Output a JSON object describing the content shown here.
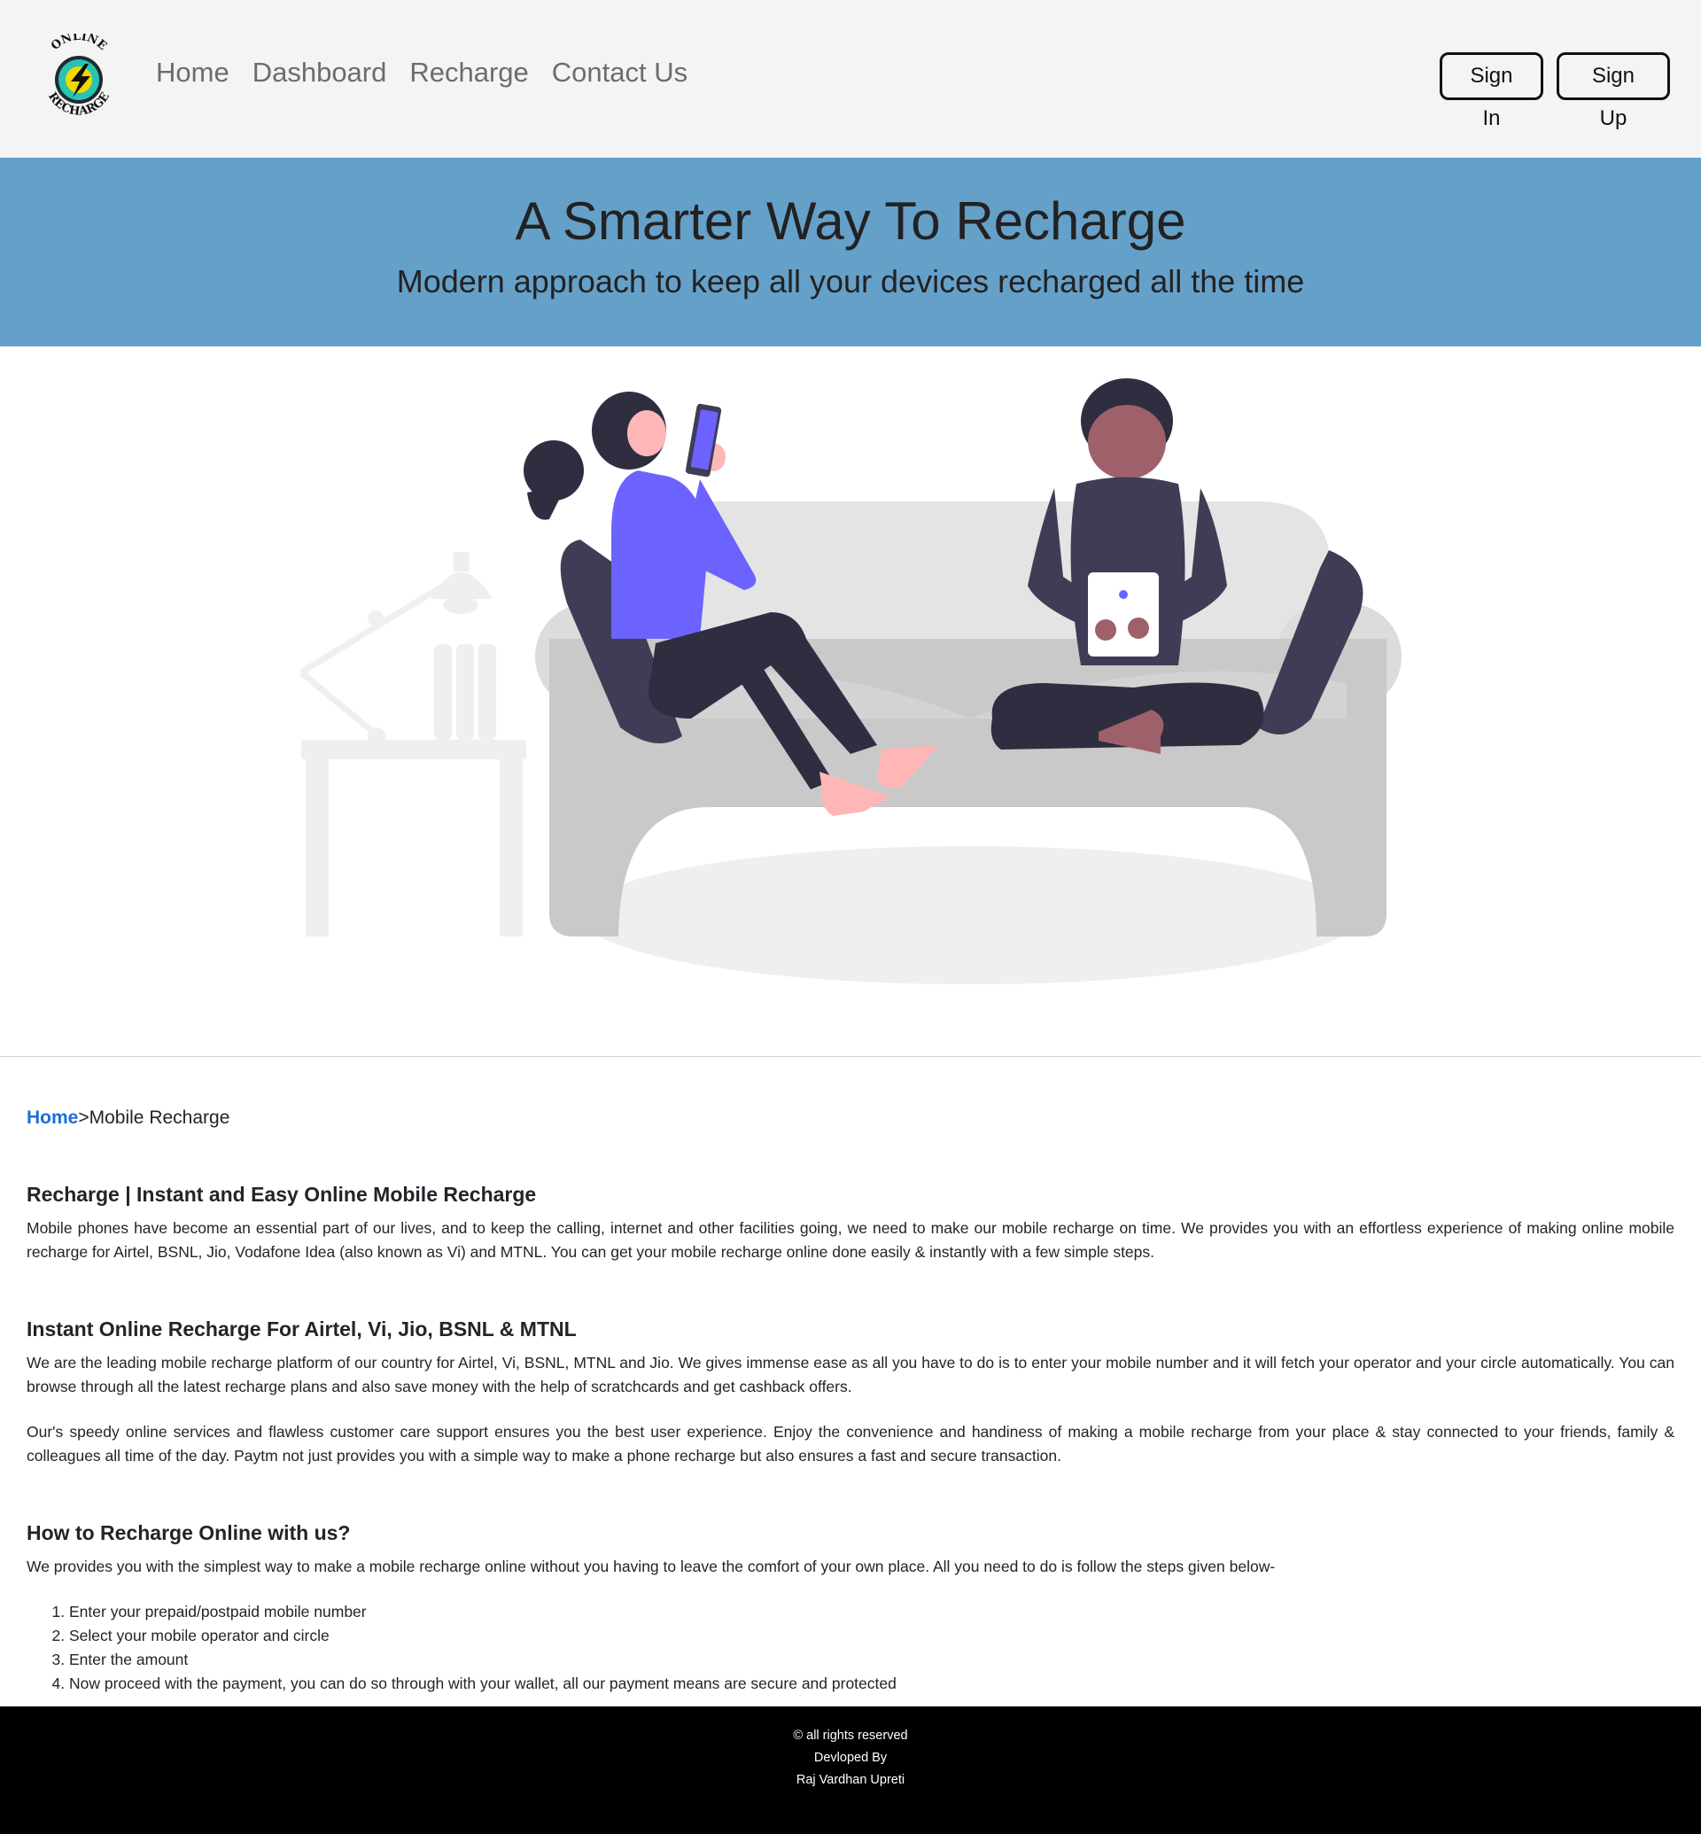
{
  "brand": {
    "logo_text_top": "ONLINE",
    "logo_text_bottom": "RECHARGE"
  },
  "nav": {
    "links": [
      "Home",
      "Dashboard",
      "Recharge",
      "Contact Us"
    ],
    "sign_in": "Sign In",
    "sign_up": "Sign Up"
  },
  "hero": {
    "title": "A Smarter Way To Recharge",
    "subtitle": "Modern approach to keep all your devices recharged all the time"
  },
  "breadcrumb": {
    "home": "Home",
    "separator": ">",
    "current": "Mobile Recharge"
  },
  "sections": [
    {
      "heading": "Recharge | Instant and Easy Online Mobile Recharge",
      "paragraphs": [
        "Mobile phones have become an essential part of our lives, and to keep the calling, internet and other facilities going, we need to make our mobile recharge on time. We provides you with an effortless experience of making online mobile recharge for Airtel, BSNL, Jio, Vodafone Idea (also known as Vi) and MTNL. You can get your mobile recharge online done easily & instantly with a few simple steps."
      ]
    },
    {
      "heading": "Instant Online Recharge For Airtel, Vi, Jio, BSNL & MTNL",
      "paragraphs": [
        "We are the leading mobile recharge platform of our country for Airtel, Vi, BSNL, MTNL and Jio. We gives immense ease as all you have to do is to enter your mobile number and it will fetch your operator and your circle automatically. You can browse through all the latest recharge plans and also save money with the help of scratchcards and get cashback offers.",
        "Our's speedy online services and flawless customer care support ensures you the best user experience. Enjoy the convenience and handiness of making a mobile recharge from your place & stay connected to your friends, family & colleagues all time of the day. Paytm not just provides you with a simple way to make a phone recharge but also ensures a fast and secure transaction."
      ]
    },
    {
      "heading": "How to Recharge Online with us?",
      "paragraphs": [
        "We provides you with the simplest way to make a mobile recharge online without you having to leave the comfort of your own place. All you need to do is follow the steps given below-"
      ],
      "steps": [
        "Enter your prepaid/postpaid mobile number",
        "Select your mobile operator and circle",
        "Enter the amount",
        "Now proceed with the payment, you can do so through with your wallet, all our payment means are secure and protected"
      ]
    }
  ],
  "footer": {
    "line1": "© all rights reserved",
    "line2": "Devloped By",
    "line3": "Raj Vardhan Upreti"
  },
  "colors": {
    "navbar_bg": "#f4f4f4",
    "hero_bg": "#65a0c9",
    "link_blue": "#1a6fd6",
    "footer_bg": "#000000",
    "illustration_accent": "#6c63ff"
  }
}
